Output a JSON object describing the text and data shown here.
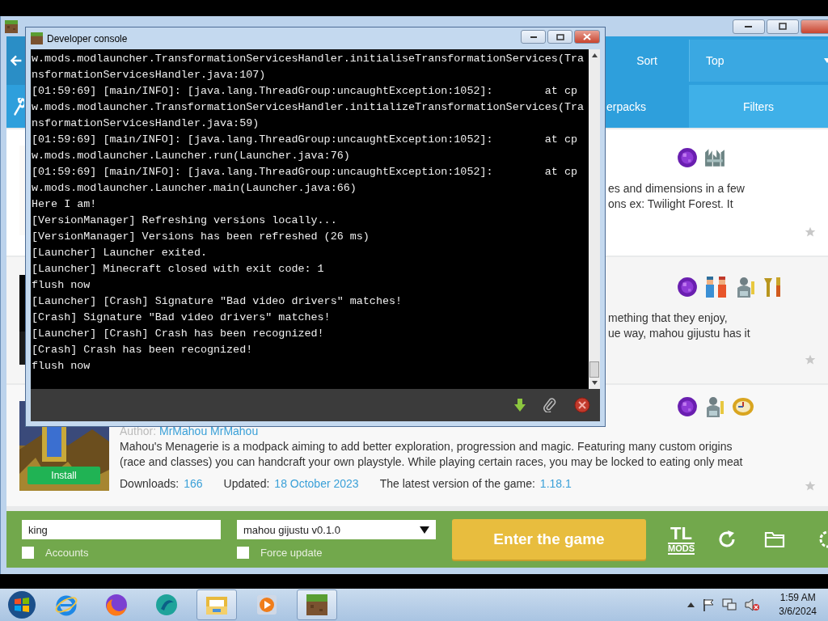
{
  "launcher": {
    "header": {
      "sort_label": "Sort",
      "sort_value": "Top",
      "tabs": [
        {
          "label": "erpacks",
          "selected": false
        },
        {
          "label": "Filters",
          "selected": true
        }
      ]
    },
    "modpacks": [
      {
        "kind": "partial",
        "tags": [
          {
            "kind": "orb"
          },
          {
            "kind": "ruins"
          }
        ],
        "description_lines": [
          "es and dimensions in a few",
          "ons ex: Twilight Forest. It"
        ]
      },
      {
        "kind": "partial",
        "tags": [
          {
            "kind": "orb"
          },
          {
            "kind": "people"
          },
          {
            "kind": "statue"
          },
          {
            "kind": "tools"
          }
        ],
        "description_lines": [
          "mething that they enjoy,",
          "ue way, mahou gijustu has it"
        ]
      },
      {
        "kind": "full",
        "install": "Install",
        "author_label": "Author:",
        "author": "MrMahou MrMahou",
        "tags": [
          {
            "kind": "orb"
          },
          {
            "kind": "statue"
          },
          {
            "kind": "clock"
          }
        ],
        "description_lines": [
          "Mahou's Menagerie is a modpack aiming to add better exploration, progression and magic. Featuring many custom origins",
          "(race and classes) you can handcraft your own playstyle. While playing certain races, you may be locked to eating only meat"
        ],
        "stats": [
          {
            "label": "Downloads:",
            "value": "166"
          },
          {
            "label": "Updated:",
            "value": "18 October 2023"
          },
          {
            "label": "The latest version of the game:",
            "value": "1.18.1"
          }
        ]
      }
    ],
    "footer": {
      "account": "king",
      "version": "mahou gijustu v0.1.0",
      "play": "Enter the game",
      "logo_top": "TL",
      "logo_bottom": "MODS",
      "checkboxes": [
        {
          "label": "Accounts",
          "checked": false
        },
        {
          "label": "Force update",
          "checked": false
        }
      ]
    }
  },
  "console": {
    "title": "Developer console",
    "lines": [
      "w.mods.modlauncher.TransformationServicesHandler.initialiseTransformationServices(Tra",
      "nsformationServicesHandler.java:107)",
      "[01:59:69] [main/INFO]: [java.lang.ThreadGroup:uncaughtException:1052]:        at cp",
      "w.mods.modlauncher.TransformationServicesHandler.initializeTransformationServices(Tra",
      "nsformationServicesHandler.java:59)",
      "[01:59:69] [main/INFO]: [java.lang.ThreadGroup:uncaughtException:1052]:        at cp",
      "w.mods.modlauncher.Launcher.run(Launcher.java:76)",
      "[01:59:69] [main/INFO]: [java.lang.ThreadGroup:uncaughtException:1052]:        at cp",
      "w.mods.modlauncher.Launcher.main(Launcher.java:66)",
      "Here I am!",
      "[VersionManager] Refreshing versions locally...",
      "[VersionManager] Versions has been refreshed (26 ms)",
      "[Launcher] Launcher exited.",
      "[Launcher] Minecraft closed with exit code: 1",
      "flush now",
      "[Launcher] [Crash] Signature \"Bad video drivers\" matches!",
      "[Crash] Signature \"Bad video drivers\" matches!",
      "[Launcher] [Crash] Crash has been recognized!",
      "[Crash] Crash has been recognized!",
      "flush now"
    ]
  },
  "taskbar": {
    "apps": [
      {
        "kind": "browser-e",
        "open": false
      },
      {
        "kind": "fox",
        "open": false
      },
      {
        "kind": "swirl",
        "open": false
      },
      {
        "kind": "folder",
        "open": true
      },
      {
        "kind": "play",
        "open": false
      },
      {
        "kind": "block",
        "open": true
      }
    ],
    "time": "1:59 AM",
    "date": "3/6/2024"
  }
}
